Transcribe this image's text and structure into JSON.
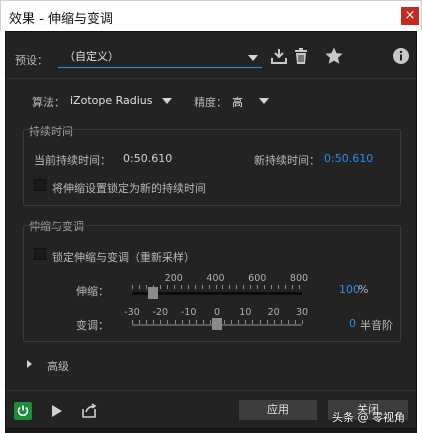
{
  "window": {
    "title": "效果 - 伸缩与变调",
    "close_label": "×"
  },
  "preset": {
    "label": "预设：",
    "value": "（自定义）"
  },
  "algorithm": {
    "label": "算法：",
    "value": "iZotope Radius"
  },
  "precision": {
    "label": "精度：",
    "value": "高"
  },
  "duration": {
    "title": "持续时间",
    "current_label": "当前持续时间：",
    "current_value": "0:50.610",
    "new_label": "新持续时间：",
    "new_value": "0:50.610",
    "lock_label": "将伸缩设置锁定为新的持续时间"
  },
  "stretch_pitch": {
    "title": "伸缩与变调",
    "lock_label": "锁定伸缩与变调（重新采样）",
    "stretch": {
      "label": "伸缩：",
      "ticks": [
        "200",
        "400",
        "600",
        "800"
      ],
      "value": "100",
      "unit": "%",
      "level": 0.125
    },
    "pitch": {
      "label": "变调：",
      "ticks": [
        "-30",
        "-20",
        "-10",
        "0",
        "10",
        "20",
        "30"
      ],
      "value": "0",
      "unit": "半音阶",
      "level": 0.5
    }
  },
  "advanced": {
    "label": "高级"
  },
  "footer": {
    "apply_label": "应用",
    "close_label": "关闭"
  },
  "watermark": {
    "text": "头条 @ 零视角"
  },
  "colors": {
    "accent": "#2d8ceb",
    "power_green": "#1e8a3a",
    "close_red": "#c42b1c"
  }
}
